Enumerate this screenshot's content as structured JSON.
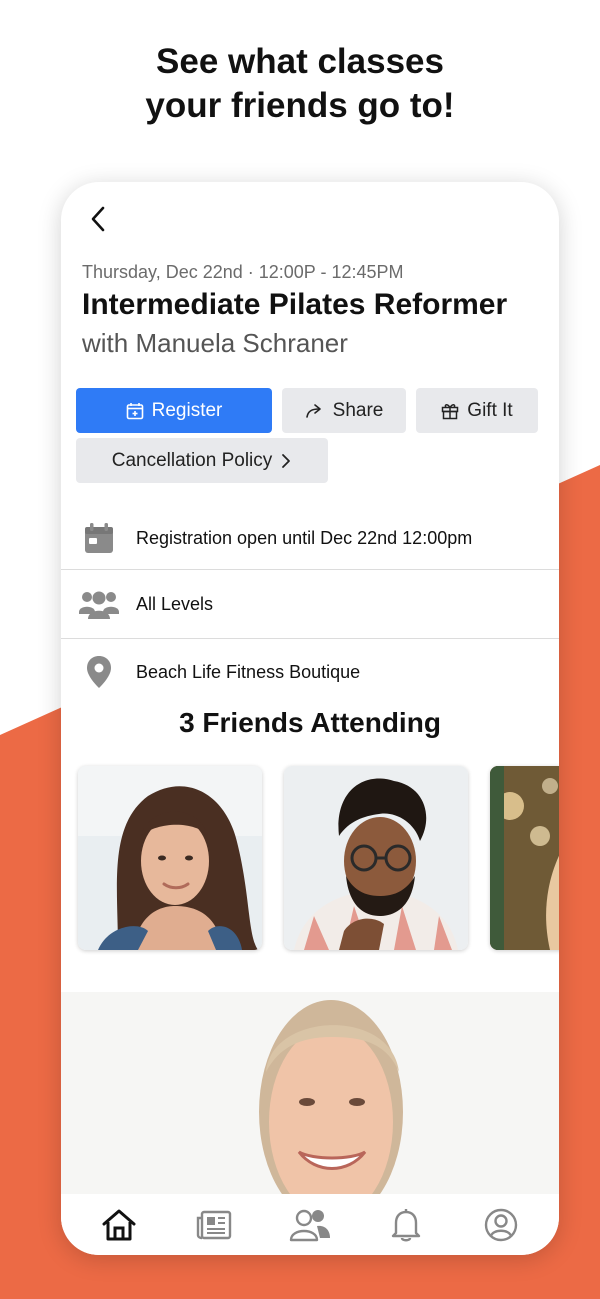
{
  "marketing": {
    "headline_line1": "See what classes",
    "headline_line2": "your friends go to!"
  },
  "colors": {
    "accent_orange": "#EC6A45",
    "register_blue": "#2F7BF6",
    "secondary_button_gray": "#E8E9EC"
  },
  "class_detail": {
    "date_time": "Thursday, Dec 22nd · 12:00P - 12:45PM",
    "title": "Intermediate Pilates Reformer",
    "instructor": "with Manuela Schraner"
  },
  "actions": {
    "register_label": "Register",
    "share_label": "Share",
    "gift_label": "Gift It",
    "cancellation_label": "Cancellation Policy"
  },
  "info_rows": [
    {
      "icon": "calendar-icon",
      "text": "Registration open until Dec 22nd 12:00pm"
    },
    {
      "icon": "people-icon",
      "text": "All Levels"
    },
    {
      "icon": "location-pin-icon",
      "text": "Beach Life Fitness Boutique"
    }
  ],
  "friends": {
    "title": "3 Friends Attending",
    "avatars": [
      "friend-woman-long-hair",
      "friend-man-glasses",
      "friend-partial-blonde"
    ]
  },
  "tabbar": {
    "items": [
      "home-icon",
      "news-icon",
      "friends-icon",
      "bell-icon",
      "profile-icon"
    ],
    "selected": "home-icon"
  }
}
